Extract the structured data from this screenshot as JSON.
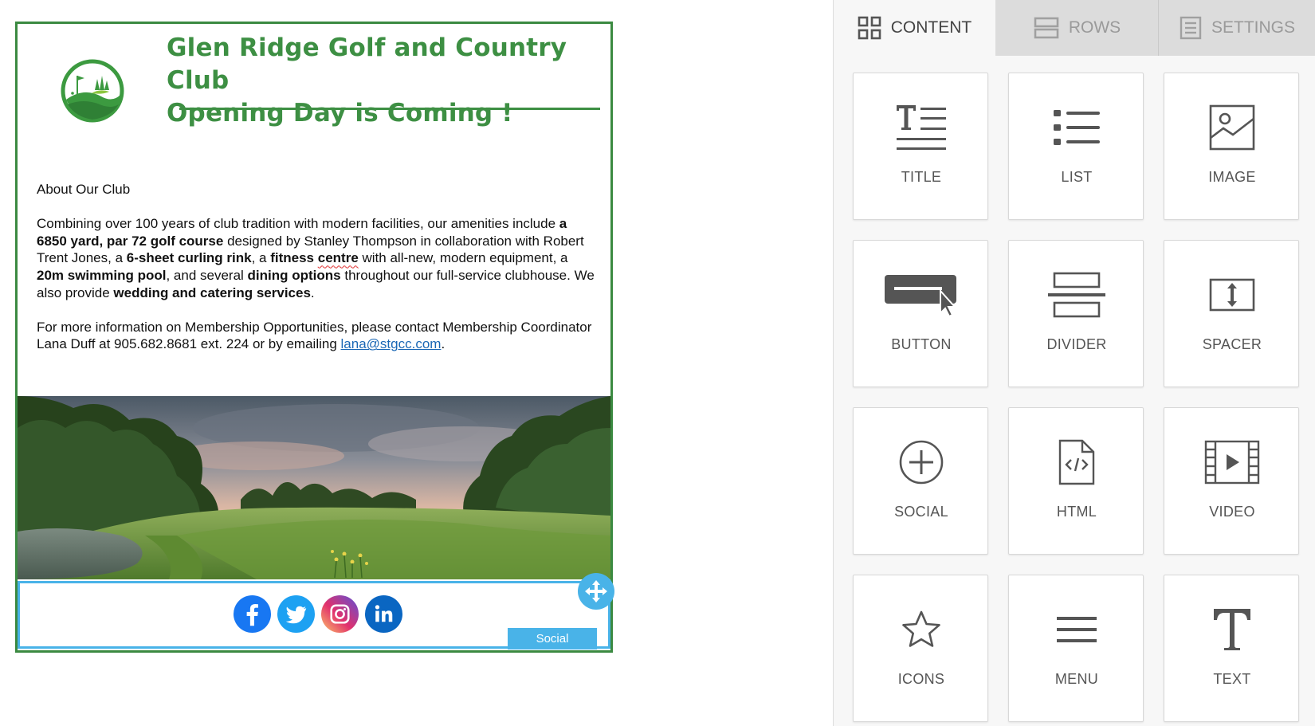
{
  "email": {
    "headline_line1": "Glen Ridge Golf and Country Club",
    "headline_line2": "Opening Day is Coming !",
    "about_heading": "About Our Club",
    "body": {
      "t1": "Combining over 100 years of club tradition with modern facilities, our amenities include ",
      "b1": "a 6850 yard, par 72 golf course",
      "t2": " designed by Stanley Thompson in collaboration with Robert Trent Jones, a ",
      "b2": "6-sheet curling rink",
      "t3": ", a ",
      "b3a": "fitness ",
      "b3b": "centre",
      "t4": " with all-new, modern equipment, a ",
      "b4": "20m swimming pool",
      "t5": ", and several ",
      "b5": "dining options",
      "t6": " throughout our full-service clubhouse. We also provide ",
      "b6": "wedding and catering services",
      "t7": "."
    },
    "contact": {
      "text": "For more information on Membership Opportunities, please contact Membership Coordinator Lana Duff at 905.682.8681 ext. 224 or by emailing ",
      "email_link": "lana@stgcc.com",
      "end": "."
    },
    "social_tag": "Social",
    "social_icons": [
      "facebook-icon",
      "twitter-icon",
      "instagram-icon",
      "linkedin-icon"
    ]
  },
  "panel": {
    "tabs": [
      {
        "label": "CONTENT",
        "icon": "grid-icon",
        "active": true
      },
      {
        "label": "ROWS",
        "icon": "rows-icon",
        "active": false
      },
      {
        "label": "SETTINGS",
        "icon": "settings-doc-icon",
        "active": false
      }
    ],
    "tiles": [
      {
        "label": "TITLE",
        "icon": "title-icon"
      },
      {
        "label": "LIST",
        "icon": "list-icon"
      },
      {
        "label": "IMAGE",
        "icon": "image-icon"
      },
      {
        "label": "BUTTON",
        "icon": "button-icon"
      },
      {
        "label": "DIVIDER",
        "icon": "divider-icon"
      },
      {
        "label": "SPACER",
        "icon": "spacer-icon"
      },
      {
        "label": "SOCIAL",
        "icon": "social-plus-icon"
      },
      {
        "label": "HTML",
        "icon": "html-file-icon"
      },
      {
        "label": "VIDEO",
        "icon": "video-icon"
      },
      {
        "label": "ICONS",
        "icon": "star-icon"
      },
      {
        "label": "MENU",
        "icon": "menu-icon"
      },
      {
        "label": "TEXT",
        "icon": "text-icon"
      }
    ]
  },
  "colors": {
    "brand_green": "#3d8f43",
    "selection_blue": "#49b3e8",
    "link_blue": "#1a67b5"
  }
}
